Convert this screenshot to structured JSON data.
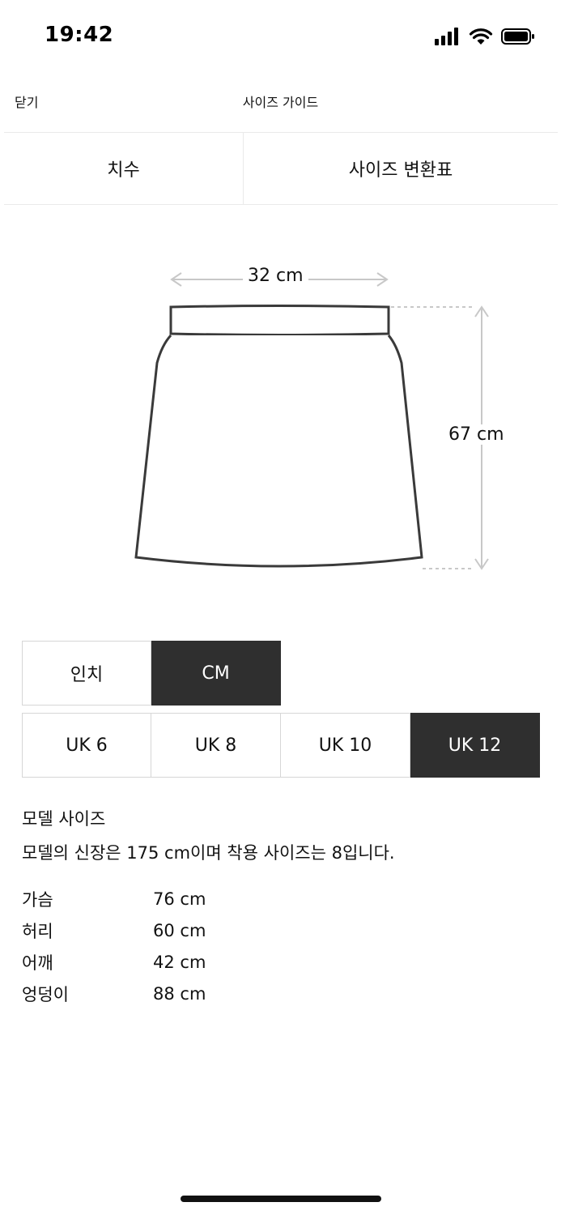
{
  "status": {
    "time": "19:42"
  },
  "nav": {
    "close_label": "닫기",
    "title": "사이즈 가이드"
  },
  "tabs": [
    {
      "label": "치수"
    },
    {
      "label": "사이즈 변환표"
    }
  ],
  "diagram": {
    "width_label": "32 cm",
    "height_label": "67 cm"
  },
  "units": {
    "options": [
      "인치",
      "CM"
    ],
    "selected": "CM"
  },
  "sizes": {
    "options": [
      "UK 6",
      "UK 8",
      "UK 10",
      "UK 12"
    ],
    "selected": "UK 12"
  },
  "model": {
    "heading": "모델 사이즈",
    "sentence": "모델의 신장은 175 cm이며 착용 사이즈는 8입니다."
  },
  "measurements": [
    {
      "name": "가슴",
      "value": "76 cm"
    },
    {
      "name": "허리",
      "value": "60 cm"
    },
    {
      "name": "어깨",
      "value": "42 cm"
    },
    {
      "name": "엉덩이",
      "value": "88 cm"
    }
  ],
  "colors": {
    "selected_bg": "#2f2f2f",
    "border": "#d6d6d6",
    "dimension_line": "#c8c8c8"
  }
}
